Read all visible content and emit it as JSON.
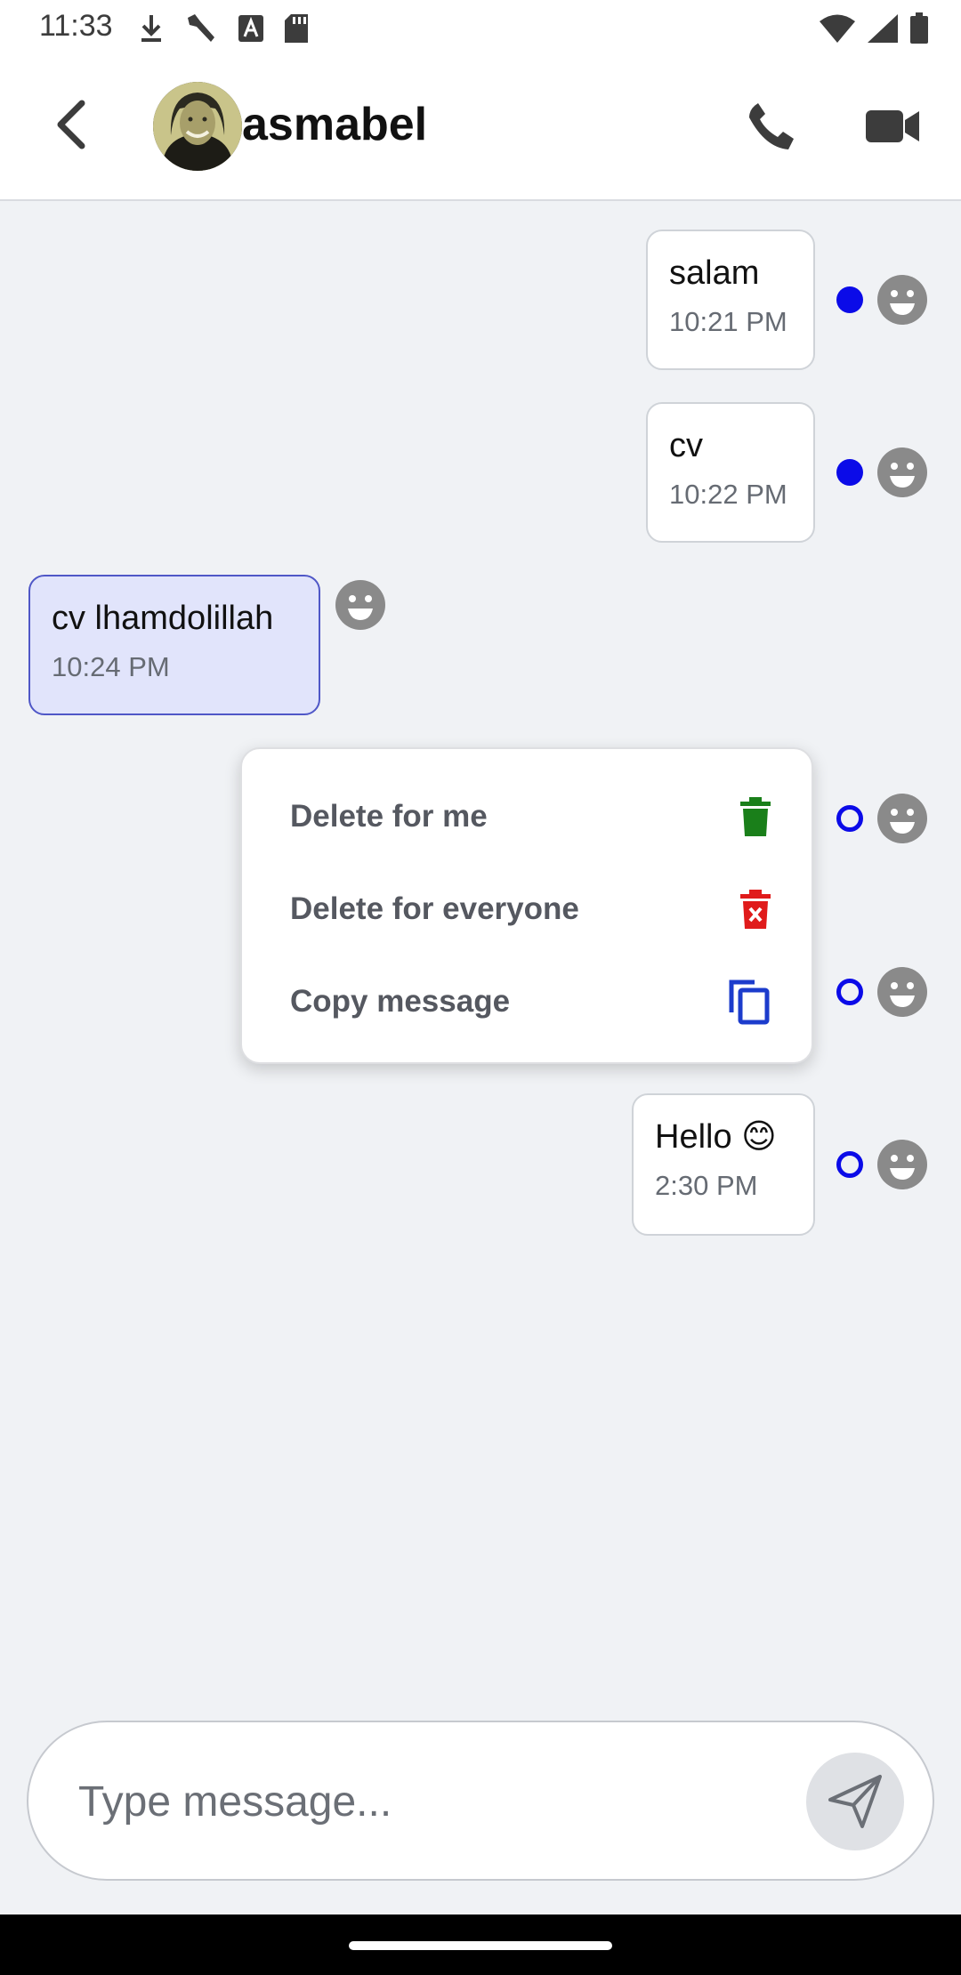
{
  "status_bar": {
    "time": "11:33",
    "left_icons": [
      "download-icon",
      "wrench-icon",
      "text-a-icon",
      "sd-card-icon"
    ],
    "right_icons": [
      "wifi-icon",
      "cell-signal-icon",
      "battery-icon"
    ]
  },
  "header": {
    "contact_name": "asmabel",
    "back_icon": "chevron-left-icon",
    "call_icon": "phone-icon",
    "video_icon": "video-camera-icon"
  },
  "messages": [
    {
      "direction": "outgoing",
      "text": "salam",
      "time": "10:21 PM",
      "status": "sent"
    },
    {
      "direction": "outgoing",
      "text": "cv",
      "time": "10:22 PM",
      "status": "sent"
    },
    {
      "direction": "incoming",
      "text": "cv lhamdolillah",
      "time": "10:24 PM"
    },
    {
      "direction": "outgoing",
      "text": "",
      "time": "",
      "status": "pending"
    },
    {
      "direction": "outgoing",
      "text": "",
      "time": "",
      "status": "pending"
    },
    {
      "direction": "outgoing",
      "text": "Hello 😊",
      "time": "2:30 PM",
      "status": "pending"
    }
  ],
  "context_menu": {
    "items": [
      {
        "label": "Delete for me",
        "icon": "trash-icon",
        "color": "#1a7f1a"
      },
      {
        "label": "Delete for everyone",
        "icon": "trash-x-icon",
        "color": "#e01b1b"
      },
      {
        "label": "Copy message",
        "icon": "copy-icon",
        "color": "#1c3ccc"
      }
    ]
  },
  "composer": {
    "placeholder": "Type message...",
    "value": "",
    "send_icon": "send-icon"
  },
  "colors": {
    "accent_blue": "#0b0be8",
    "incoming_bubble": "#e1e4fb",
    "incoming_border": "#4f57c7",
    "background": "#f0f2f5"
  }
}
